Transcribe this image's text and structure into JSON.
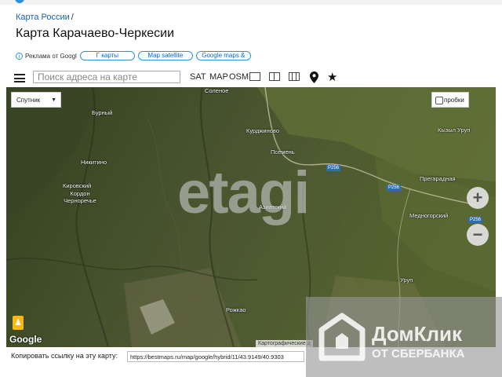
{
  "breadcrumb": {
    "link": "Карта России",
    "sep": "/"
  },
  "page_title": "Карта Карачаево-Черкесии",
  "ad_row": {
    "ad_label": "Реклама от Googl",
    "chips": [
      "Г карты",
      "Map satellite",
      "Google maps &"
    ]
  },
  "toolbar": {
    "search_placeholder": "Поиск адреса на карте",
    "sat": "SAT",
    "map": "MAP",
    "osm": "OSM"
  },
  "map": {
    "map_type_select": "Спутник",
    "traffic_label": "пробки",
    "zoom_in": "+",
    "zoom_out": "−",
    "google_logo": "Google",
    "attribution": "Картографические д",
    "watermark": "etagi",
    "places": [
      "Соленое",
      "Бурный",
      "Курджиново",
      "Псемень",
      "Кызыл Уруп",
      "Никитино",
      "Прегарадная",
      "Кировский",
      "Кордон Черноречье",
      "Азиатский",
      "Медногорский",
      "Уруп",
      "Рожкао"
    ],
    "roads": [
      "Р256",
      "Р256",
      "Р256"
    ]
  },
  "linkbar": {
    "label": "Копировать ссылку на эту карту:",
    "url": "https://bestmaps.ru/map/google/hybrid/11/43.9149/40.9303"
  },
  "domclick": {
    "title": "ДомКлик",
    "subtitle": "ОТ СБЕРБАНКА"
  },
  "colors": {
    "link": "#1a5fb4",
    "accent": "#2f8fd8",
    "road_badge": "#2e6eb8"
  }
}
